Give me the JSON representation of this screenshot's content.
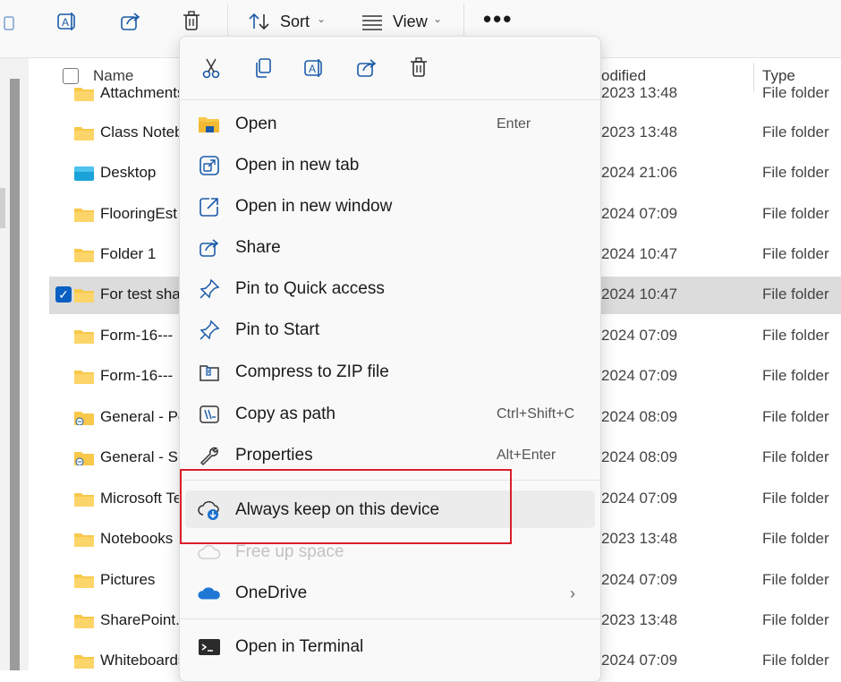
{
  "toolbar": {
    "sort_label": "Sort",
    "view_label": "View",
    "more_label": "•••"
  },
  "columns": {
    "name": "Name",
    "modified": "odified",
    "type": "Type"
  },
  "rows": [
    {
      "name": "Attachments",
      "date": "2023 13:48",
      "type": "File folder",
      "icon": "folder-icon"
    },
    {
      "name": "Class Notebooks",
      "date": "2023 13:48",
      "type": "File folder",
      "icon": "folder-icon"
    },
    {
      "name": "Desktop",
      "date": "2024 21:06",
      "type": "File folder",
      "icon": "desktop-folder-icon"
    },
    {
      "name": "FlooringEst",
      "date": "2024 07:09",
      "type": "File folder",
      "icon": "folder-icon"
    },
    {
      "name": "Folder 1",
      "date": "2024 10:47",
      "type": "File folder",
      "icon": "folder-icon"
    },
    {
      "name": "For test sharing",
      "date": "2024 10:47",
      "type": "File folder",
      "icon": "folder-icon",
      "selected": true
    },
    {
      "name": "Form-16---",
      "date": "2024 07:09",
      "type": "File folder",
      "icon": "folder-icon"
    },
    {
      "name": "Form-16---",
      "date": "2024 07:09",
      "type": "File folder",
      "icon": "folder-icon"
    },
    {
      "name": "General - Pe",
      "date": "2024 08:09",
      "type": "File folder",
      "icon": "shared-folder-icon"
    },
    {
      "name": "General - Si",
      "date": "2024 08:09",
      "type": "File folder",
      "icon": "shared-folder-icon"
    },
    {
      "name": "Microsoft Te",
      "date": "2024 07:09",
      "type": "File folder",
      "icon": "folder-icon"
    },
    {
      "name": "Notebooks",
      "date": "2023 13:48",
      "type": "File folder",
      "icon": "folder-icon"
    },
    {
      "name": "Pictures",
      "date": "2024 07:09",
      "type": "File folder",
      "icon": "folder-icon"
    },
    {
      "name": "SharePoint.C",
      "date": "2023 13:48",
      "type": "File folder",
      "icon": "folder-icon"
    },
    {
      "name": "Whiteboards",
      "date": "2024 07:09",
      "type": "File folder",
      "icon": "folder-icon"
    }
  ],
  "context_menu": {
    "quick_actions": [
      "cut-icon",
      "copy-icon",
      "rename-icon",
      "share-icon",
      "delete-icon"
    ],
    "items": [
      {
        "label": "Open",
        "shortcut": "Enter",
        "icon": "folder-open-icon"
      },
      {
        "label": "Open in new tab",
        "shortcut": "",
        "icon": "new-tab-icon"
      },
      {
        "label": "Open in new window",
        "shortcut": "",
        "icon": "new-window-icon"
      },
      {
        "label": "Share",
        "shortcut": "",
        "icon": "share-icon"
      },
      {
        "label": "Pin to Quick access",
        "shortcut": "",
        "icon": "pin-icon"
      },
      {
        "label": "Pin to Start",
        "shortcut": "",
        "icon": "pin-icon"
      },
      {
        "label": "Compress to ZIP file",
        "shortcut": "",
        "icon": "zip-icon"
      },
      {
        "label": "Copy as path",
        "shortcut": "Ctrl+Shift+C",
        "icon": "copy-path-icon"
      },
      {
        "label": "Properties",
        "shortcut": "Alt+Enter",
        "icon": "wrench-icon"
      },
      {
        "label": "Always keep on this device",
        "shortcut": "",
        "icon": "cloud-download-icon"
      },
      {
        "label": "Free up space",
        "shortcut": "",
        "icon": "cloud-icon"
      },
      {
        "label": "OneDrive",
        "shortcut": "",
        "icon": "onedrive-icon"
      },
      {
        "label": "Open in Terminal",
        "shortcut": "",
        "icon": "terminal-icon"
      }
    ]
  },
  "colors": {
    "accent": "#0a5fc2",
    "highlight_box": "#d9202a",
    "folder_yellow": "#f8c84a"
  }
}
